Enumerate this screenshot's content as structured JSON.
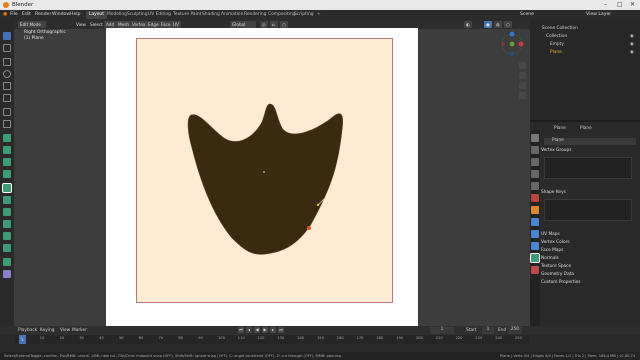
{
  "window": {
    "title": "Blender",
    "controls": [
      "–",
      "□",
      "✕"
    ]
  },
  "menu": [
    "File",
    "Edit",
    "Render",
    "Window",
    "Help"
  ],
  "workspaces": [
    "Layout",
    "Modeling",
    "Sculpting",
    "UV Editing",
    "Texture Paint",
    "Shading",
    "Animation",
    "Rendering",
    "Compositing",
    "Scripting",
    "+"
  ],
  "active_workspace": "Layout",
  "scene_label": "Scene",
  "view_layer_label": "View Layer",
  "viewport_header": {
    "mode": "Edit Mode",
    "view": "View",
    "select": "Select",
    "add": "Add",
    "mesh": "Mesh",
    "vertex": "Vertex",
    "edge": "Edge",
    "face": "Face",
    "uv": "UV",
    "orientation": "Global"
  },
  "viewport_overlay": {
    "view_name": "Right Orthographic",
    "object_name": "(1) Plane"
  },
  "outliner": {
    "root": "Scene Collection",
    "collection": "Collection",
    "items": [
      "Empty",
      "Plane"
    ]
  },
  "properties": {
    "object_name": "Plane",
    "mesh_tab_label": "Plane",
    "data_name": "Plane",
    "sections": {
      "vertex_groups": "Vertex Groups",
      "shape_keys": "Shape Keys",
      "uv_maps": "UV Maps",
      "vertex_colors": "Vertex Colors",
      "face_maps": "Face Maps",
      "normals": "Normals",
      "texture_space": "Texture Space",
      "geometry_data": "Geometry Data",
      "custom_properties": "Custom Properties"
    }
  },
  "timeline": {
    "playback": "Playback",
    "keying": "Keying",
    "view": "View",
    "marker": "Marker",
    "current_frame": "1",
    "start_label": "Start",
    "start": "1",
    "end_label": "End",
    "end": "250",
    "ticks": [
      "0",
      "10",
      "20",
      "30",
      "40",
      "50",
      "60",
      "70",
      "80",
      "90",
      "100",
      "110",
      "120",
      "130",
      "140",
      "150",
      "160",
      "170",
      "180",
      "190",
      "200",
      "210",
      "220",
      "230",
      "240",
      "250"
    ]
  },
  "status": {
    "left": "Select/Extend/Toggle, confirm, Esc/RMB: cancel, LMB: new cut, Ctrl/Cmd: midpoint snap (OFF), Shift/Shift: ignore snap (OFF), C: angle constraint (OFF), Z: cut through (OFF), MMB: panning",
    "right": "Plane | Verts 4/4 | Edges 4/4 | Faces 1/1 | Tris 2 | Mem: 164.4 MB | v2.80.74"
  },
  "colors": {
    "shape_fill": "#3a2a10",
    "sheet": "#fdebd3",
    "accent": "#4772b3"
  }
}
